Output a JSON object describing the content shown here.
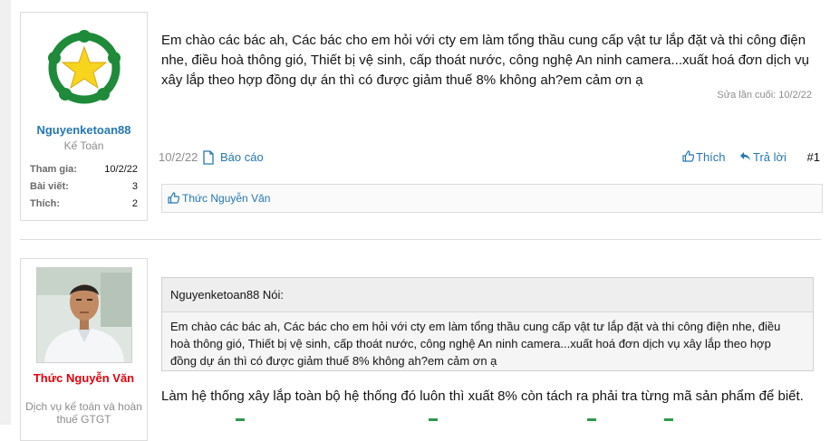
{
  "post1": {
    "author": {
      "name": "Nguyenketoan88",
      "title": "Kế Toán",
      "stats": [
        {
          "label": "Tham gia:",
          "value": "10/2/22"
        },
        {
          "label": "Bài viết:",
          "value": "3"
        },
        {
          "label": "Thích:",
          "value": "2"
        }
      ],
      "avatar_icon": "green-wreath-star-logo"
    },
    "content": "Em chào các bác ah, Các bác cho em hỏi với cty em làm tổng thầu cung cấp vật tư lắp đặt và thi công điện nhe, điều hoà thông gió, Thiết bị vệ sinh, cấp thoát nước, công nghệ An ninh camera...xuất hoá đơn dịch vụ xây lắp theo hợp đồng dự án thì có được giảm thuế 8% không ah?em cảm ơn ạ",
    "edited": "Sửa lần cuối: 10/2/22",
    "date": "10/2/22",
    "report_label": "Báo cáo",
    "like_label": "Thích",
    "reply_label": "Trả lời",
    "number": "#1",
    "liked_by": "Thức Nguyễn Văn"
  },
  "post2": {
    "author": {
      "name": "Thức Nguyễn Văn",
      "title": "Dịch vụ kế toán và hoàn thuế GTGT",
      "avatar_icon": "user-photo"
    },
    "quote": {
      "author": "Nguyenketoan88 Nói:",
      "text": "Em chào các bác ah, Các bác cho em hỏi với cty em làm tổng thầu cung cấp vật tư lắp đặt và thi công điện nhe, điều hoà thông gió, Thiết bị vệ sinh, cấp thoát nước, công nghệ An ninh camera...xuất hoá đơn dịch vụ xây lắp theo hợp đồng dự án thì có được giảm thuế 8% không ah?em cảm ơn ạ"
    },
    "content": "Làm hệ thống xây lắp toàn bộ hệ thống đó luôn thì xuất 8% còn tách ra phải tra từng mã sản phẩm để biết."
  },
  "colors": {
    "link": "#2577b1",
    "author2": "#e0000b",
    "logo_green": "#1e8a3a",
    "star_yellow": "#f7d51d"
  }
}
